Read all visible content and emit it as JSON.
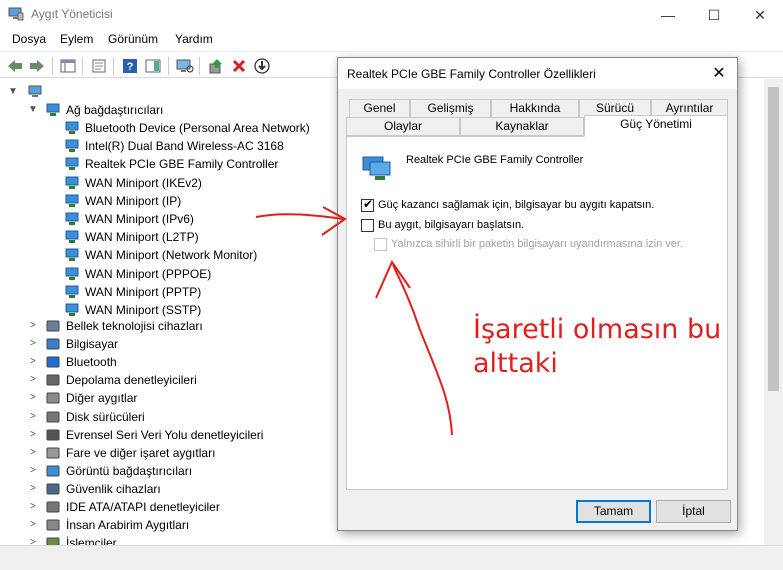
{
  "window": {
    "title": "Aygıt Yöneticisi",
    "minimize": "—",
    "maximize": "☐",
    "close": "✕"
  },
  "menu": [
    "Dosya",
    "Eylem",
    "Görünüm",
    "Yardım"
  ],
  "tree": {
    "expanded_category": "Ağ bağdaştırıcıları",
    "adapters": [
      "Bluetooth Device (Personal Area Network)",
      "Intel(R) Dual Band Wireless-AC 3168",
      "Realtek PCIe GBE Family Controller",
      "WAN Miniport (IKEv2)",
      "WAN Miniport (IP)",
      "WAN Miniport (IPv6)",
      "WAN Miniport (L2TP)",
      "WAN Miniport (Network Monitor)",
      "WAN Miniport (PPPOE)",
      "WAN Miniport (PPTP)",
      "WAN Miniport (SSTP)"
    ],
    "categories": [
      "Bellek teknolojisi cihazları",
      "Bilgisayar",
      "Bluetooth",
      "Depolama denetleyicileri",
      "Diğer aygıtlar",
      "Disk sürücüleri",
      "Evrensel Seri Veri Yolu denetleyicileri",
      "Fare ve diğer işaret aygıtları",
      "Görüntü bağdaştırıcıları",
      "Güvenlik cihazları",
      "IDE ATA/ATAPI denetleyiciler",
      "İnsan Arabirim Aygıtları",
      "İşlemciler"
    ]
  },
  "dialog": {
    "title": "Realtek PCIe GBE Family Controller Özellikleri",
    "tabs_row1": [
      "Genel",
      "Gelişmiş",
      "Hakkında",
      "Sürücü",
      "Ayrıntılar"
    ],
    "tabs_row2": [
      "Olaylar",
      "Kaynaklar",
      "Güç Yönetimi"
    ],
    "device_name": "Realtek PCIe GBE Family Controller",
    "options": [
      {
        "label": "Güç kazancı sağlamak için, bilgisayar bu aygıtı kapatsın.",
        "checked": true,
        "enabled": true
      },
      {
        "label": "Bu aygıt, bilgisayarı başlatsın.",
        "checked": false,
        "enabled": true
      },
      {
        "label": "Yalnızca sihirli bir paketin bilgisayarı uyandırmasına izin ver.",
        "checked": false,
        "enabled": false
      }
    ],
    "ok": "Tamam",
    "cancel": "İptal"
  },
  "annotation": {
    "line1": "İşaretli olmasın bu",
    "line2": "alttaki",
    "color": "#e02020"
  },
  "colors": {
    "accent": "#0078d7",
    "network_icon": "#3a8fd8"
  }
}
